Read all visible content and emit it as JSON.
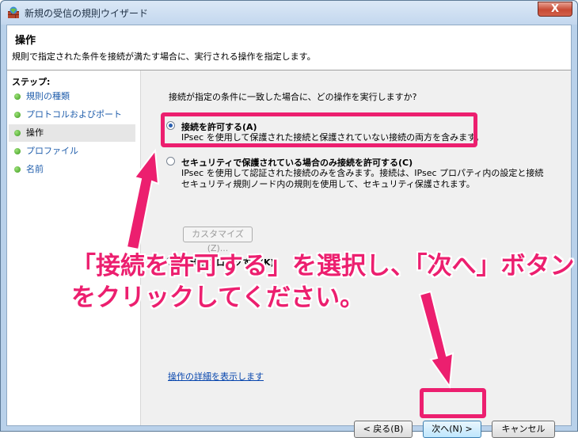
{
  "window": {
    "title": "新規の受信の規則ウイザード",
    "close_glyph": "X"
  },
  "header": {
    "title": "操作",
    "description": "規則で指定された条件を接続が満たす場合に、実行される操作を指定します。"
  },
  "steps": {
    "label": "ステップ:",
    "items": [
      {
        "label": "規則の種類",
        "current": false
      },
      {
        "label": "プロトコルおよびポート",
        "current": false
      },
      {
        "label": "操作",
        "current": true
      },
      {
        "label": "プロファイル",
        "current": false
      },
      {
        "label": "名前",
        "current": false
      }
    ]
  },
  "main": {
    "question": "接続が指定の条件に一致した場合に、どの操作を実行しますか?",
    "options": [
      {
        "label": "接続を許可する(A)",
        "selected": true,
        "description": [
          "IPsec を使用して保護された接続と保護されていない接続の両方を含みます。"
        ]
      },
      {
        "label": "セキュリティで保護されている場合のみ接続を許可する(C)",
        "selected": false,
        "description": [
          "IPsec を使用して認証された接続のみを含みます。接続は、IPsec プロパティ内の設定と接続",
          "セキュリティ規則ノード内の規則を使用して、セキュリティ保護されます。"
        ]
      },
      {
        "label": "接続をブロックする(K)",
        "selected": false,
        "description": []
      }
    ],
    "customize_button": "カスタマイズ(Z)...",
    "details_link": "操作の詳細を表示します"
  },
  "buttons": {
    "back": "< 戻る(B)",
    "next": "次へ(N) >",
    "cancel": "キャンセル"
  },
  "annotation": {
    "line1": "「接続を許可する」を選択し、「次へ」ボタン",
    "line2": "をクリックしてください。",
    "color": "#ec1f6f"
  }
}
